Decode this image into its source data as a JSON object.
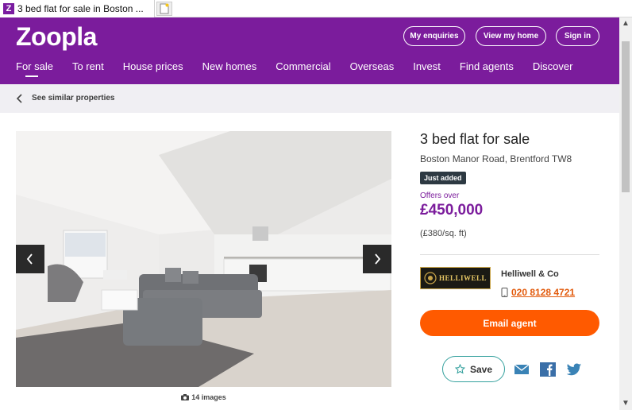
{
  "browser": {
    "tab_title": "3 bed flat for sale in Boston ...",
    "favicon_letter": "Z"
  },
  "header": {
    "logo": "Zoopla",
    "buttons": [
      "My enquiries",
      "View my home",
      "Sign in"
    ],
    "nav": [
      "For sale",
      "To rent",
      "House prices",
      "New homes",
      "Commercial",
      "Overseas",
      "Invest",
      "Find agents",
      "Discover"
    ],
    "active_nav": "For sale",
    "brand_color": "#7b1c9c"
  },
  "breadcrumb": {
    "back_label": "See similar properties",
    "icon": "chevron-left-icon"
  },
  "gallery": {
    "image_count_label": "14 images",
    "prev_icon": "chevron-left-icon",
    "next_icon": "chevron-right-icon",
    "camera_icon": "camera-icon"
  },
  "listing": {
    "title": "3 bed flat for sale",
    "address": "Boston Manor Road, Brentford TW8",
    "badge": "Just added",
    "offer_label": "Offers over",
    "price": "£450,000",
    "price_per_sqft": "(£380/sq. ft)"
  },
  "agent": {
    "logo_text": "HELLIWELL",
    "name": "Helliwell & Co",
    "phone": "020 8128 4721",
    "email_button": "Email agent",
    "accent_color": "#ff5a00"
  },
  "actions": {
    "save_label": "Save",
    "share_icons": [
      "email-icon",
      "facebook-icon",
      "twitter-icon"
    ]
  }
}
